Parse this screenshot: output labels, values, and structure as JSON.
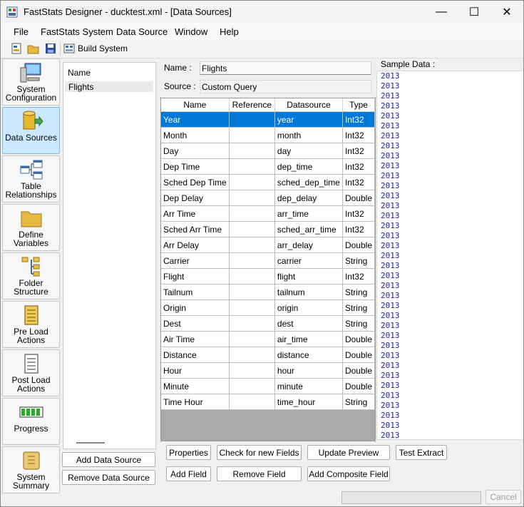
{
  "window": {
    "title": "FastStats Designer - ducktest.xml - [Data Sources]",
    "minimize": "—",
    "maximize": "☐",
    "close": "✕"
  },
  "menu": [
    "File",
    "FastStats System",
    "Data Source",
    "Window",
    "Help"
  ],
  "toolbar": {
    "build_label": "Build System"
  },
  "nav": [
    {
      "label": "System Configuration",
      "icon": "computer-icon",
      "active": false
    },
    {
      "label": "Data Sources",
      "icon": "database-icon",
      "active": true
    },
    {
      "label": "Table Relationships",
      "icon": "tables-icon",
      "active": false
    },
    {
      "label": "Define Variables",
      "icon": "folder-icon",
      "active": false
    },
    {
      "label": "Folder Structure",
      "icon": "folder-tree-icon",
      "active": false
    },
    {
      "label": "Pre Load Actions",
      "icon": "pre-load-icon",
      "active": false
    },
    {
      "label": "Post Load Actions",
      "icon": "post-load-icon",
      "active": false
    },
    {
      "label": "Progress",
      "icon": "progress-icon",
      "active": false
    },
    {
      "label": "System Summary",
      "icon": "scroll-icon",
      "active": false
    }
  ],
  "datasource_list": {
    "header": "Name",
    "items": [
      "Flights"
    ]
  },
  "buttons": {
    "add_data_source": "Add Data Source",
    "remove_data_source": "Remove Data Source",
    "properties": "Properties",
    "check_new_fields": "Check for new Fields",
    "update_preview": "Update Preview",
    "test_extract": "Test Extract",
    "add_field": "Add Field",
    "remove_field": "Remove Field",
    "add_composite_field": "Add Composite Field",
    "cancel": "Cancel"
  },
  "form": {
    "name_label": "Name :",
    "name_value": "Flights",
    "source_label": "Source :",
    "source_value": "Custom Query"
  },
  "grid": {
    "columns": [
      "Name",
      "Reference",
      "Datasource",
      "Type"
    ],
    "rows": [
      [
        "Year",
        "",
        "year",
        "Int32"
      ],
      [
        "Month",
        "",
        "month",
        "Int32"
      ],
      [
        "Day",
        "",
        "day",
        "Int32"
      ],
      [
        "Dep Time",
        "",
        "dep_time",
        "Int32"
      ],
      [
        "Sched Dep Time",
        "",
        "sched_dep_time",
        "Int32"
      ],
      [
        "Dep Delay",
        "",
        "dep_delay",
        "Double"
      ],
      [
        "Arr Time",
        "",
        "arr_time",
        "Int32"
      ],
      [
        "Sched Arr Time",
        "",
        "sched_arr_time",
        "Int32"
      ],
      [
        "Arr Delay",
        "",
        "arr_delay",
        "Double"
      ],
      [
        "Carrier",
        "",
        "carrier",
        "String"
      ],
      [
        "Flight",
        "",
        "flight",
        "Int32"
      ],
      [
        "Tailnum",
        "",
        "tailnum",
        "String"
      ],
      [
        "Origin",
        "",
        "origin",
        "String"
      ],
      [
        "Dest",
        "",
        "dest",
        "String"
      ],
      [
        "Air Time",
        "",
        "air_time",
        "Double"
      ],
      [
        "Distance",
        "",
        "distance",
        "Double"
      ],
      [
        "Hour",
        "",
        "hour",
        "Double"
      ],
      [
        "Minute",
        "",
        "minute",
        "Double"
      ],
      [
        "Time Hour",
        "",
        "time_hour",
        "String"
      ]
    ],
    "selected_row": 0
  },
  "sample": {
    "label": "Sample Data :",
    "values": [
      "2013",
      "2013",
      "2013",
      "2013",
      "2013",
      "2013",
      "2013",
      "2013",
      "2013",
      "2013",
      "2013",
      "2013",
      "2013",
      "2013",
      "2013",
      "2013",
      "2013",
      "2013",
      "2013",
      "2013",
      "2013",
      "2013",
      "2013",
      "2013",
      "2013",
      "2013",
      "2013",
      "2013",
      "2013",
      "2013",
      "2013",
      "2013",
      "2013",
      "2013",
      "2013",
      "2013",
      "2013"
    ]
  },
  "colors": {
    "accent": "#0078d7",
    "nav_active": "#cce8ff",
    "sample_text": "#2222aa"
  }
}
